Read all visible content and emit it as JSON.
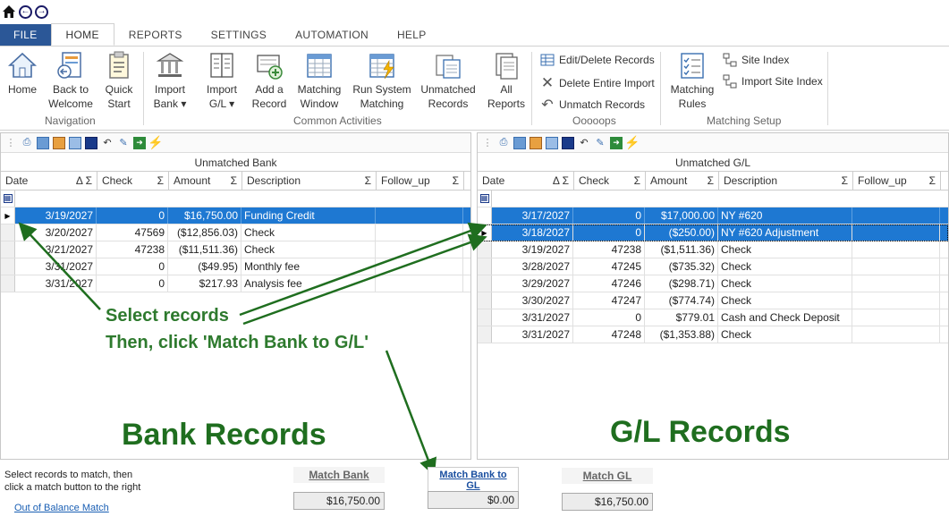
{
  "tabs": [
    "FILE",
    "HOME",
    "REPORTS",
    "SETTINGS",
    "AUTOMATION",
    "HELP"
  ],
  "ribbon": {
    "home": "Home",
    "back_line1": "Back to",
    "back_line2": "Welcome",
    "quick_line1": "Quick",
    "quick_line2": "Start",
    "nav_label": "Navigation",
    "import_bank_line1": "Import",
    "import_bank_line2": "Bank",
    "import_gl_line1": "Import",
    "import_gl_line2": "G/L",
    "add_line1": "Add a",
    "add_line2": "Record",
    "matching_line1": "Matching",
    "matching_line2": "Window",
    "run_line1": "Run System",
    "run_line2": "Matching",
    "unmatched_line1": "Unmatched",
    "unmatched_line2": "Records",
    "all_line1": "All",
    "all_line2": "Reports",
    "common_label": "Common Activities",
    "edit_delete": "Edit/Delete Records",
    "delete_import": "Delete Entire Import",
    "unmatch": "Unmatch Records",
    "oops_label": "Ooooops",
    "rules_line1": "Matching",
    "rules_line2": "Rules",
    "site_index": "Site Index",
    "import_site": "Import Site Index",
    "setup_label": "Matching Setup"
  },
  "bank": {
    "title": "Unmatched Bank",
    "columns": [
      "Date",
      "Check",
      "Amount",
      "Description",
      "Follow_up"
    ],
    "rows": [
      {
        "date": "3/19/2027",
        "check": "0",
        "amount": "$16,750.00",
        "desc": "Funding Credit"
      },
      {
        "date": "3/20/2027",
        "check": "47569",
        "amount": "($12,856.03)",
        "desc": "Check"
      },
      {
        "date": "3/21/2027",
        "check": "47238",
        "amount": "($11,511.36)",
        "desc": "Check"
      },
      {
        "date": "3/31/2027",
        "check": "0",
        "amount": "($49.95)",
        "desc": "Monthly fee"
      },
      {
        "date": "3/31/2027",
        "check": "0",
        "amount": "$217.93",
        "desc": "Analysis fee"
      }
    ]
  },
  "gl": {
    "title": "Unmatched G/L",
    "columns": [
      "Date",
      "Check",
      "Amount",
      "Description",
      "Follow_up"
    ],
    "rows": [
      {
        "date": "3/17/2027",
        "check": "0",
        "amount": "$17,000.00",
        "desc": "NY #620"
      },
      {
        "date": "3/18/2027",
        "check": "0",
        "amount": "($250.00)",
        "desc": "NY #620 Adjustment"
      },
      {
        "date": "3/19/2027",
        "check": "47238",
        "amount": "($1,511.36)",
        "desc": "Check"
      },
      {
        "date": "3/28/2027",
        "check": "47245",
        "amount": "($735.32)",
        "desc": "Check"
      },
      {
        "date": "3/29/2027",
        "check": "47246",
        "amount": "($298.71)",
        "desc": "Check"
      },
      {
        "date": "3/30/2027",
        "check": "47247",
        "amount": "($774.74)",
        "desc": "Check"
      },
      {
        "date": "3/31/2027",
        "check": "0",
        "amount": "$779.01",
        "desc": "Cash and Check Deposit"
      },
      {
        "date": "3/31/2027",
        "check": "47248",
        "amount": "($1,353.88)",
        "desc": "Check"
      }
    ]
  },
  "annotations": {
    "line1": "Select records",
    "line2": "Then, click 'Match Bank to G/L'",
    "bank_big": "Bank Records",
    "gl_big": "G/L Records"
  },
  "bottom": {
    "instr_line1": "Select records to match, then",
    "instr_line2": "click a match button to the right",
    "out_of_balance": "Out of Balance Match",
    "match_bank": "Match Bank",
    "match_bank_gl": "Match Bank to GL",
    "match_gl": "Match GL",
    "bank_total": "$16,750.00",
    "diff_total": "$0.00",
    "gl_total": "$16,750.00"
  },
  "colors": {
    "file_tab": "#2b5797",
    "selection": "#1e78d2",
    "annotation": "#1f6e1f"
  }
}
